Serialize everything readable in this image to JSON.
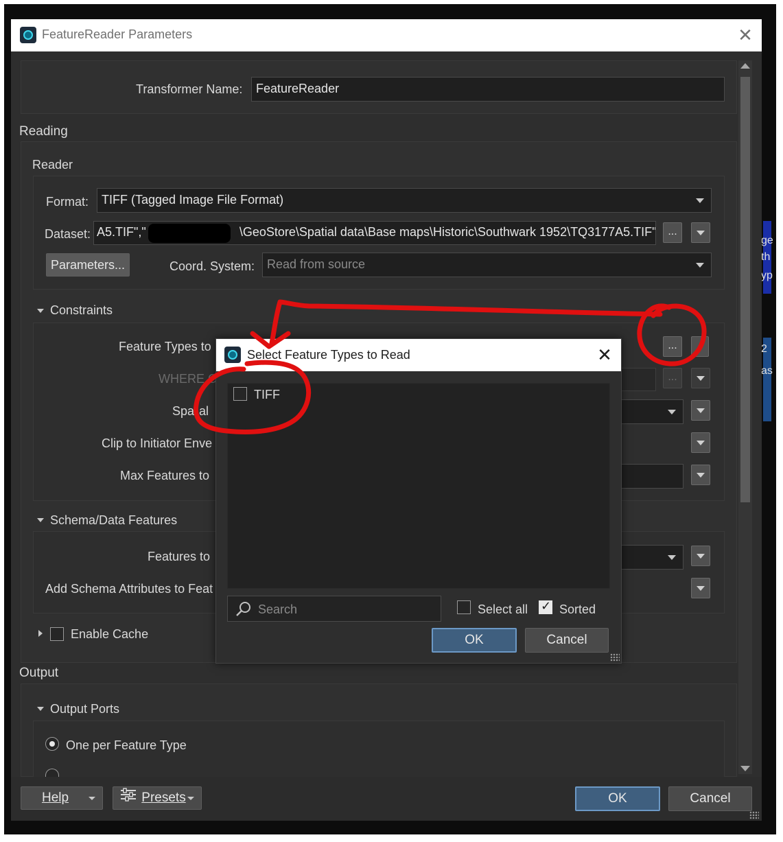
{
  "window": {
    "title": "FeatureReader Parameters",
    "close_glyph": "✕"
  },
  "transformer": {
    "label": "Transformer Name:",
    "value": "FeatureReader"
  },
  "reading": {
    "title": "Reading",
    "reader": {
      "title": "Reader",
      "format_label": "Format:",
      "format_value": "TIFF (Tagged Image File Format)",
      "dataset_label": "Dataset:",
      "dataset_value_start": "A5.TIF\",\"",
      "dataset_value_end": "\\GeoStore\\Spatial data\\Base maps\\Historic\\Southwark 1952\\TQ3177A5.TIF\"",
      "browse_label": "...",
      "parameters_button": "Parameters...",
      "coord_label": "Coord. System:",
      "coord_placeholder": "Read from source"
    },
    "constraints": {
      "title": "Constraints",
      "feature_types_label": "Feature Types to",
      "where_label": "WHERE C",
      "spatial_label_a": "Spa",
      "spatial_label_b": "al",
      "clip_label": "Clip to Initiator Enve",
      "max_features_label": "Max Features to",
      "browse_label": "...",
      "browse_label_2": "..."
    },
    "schema": {
      "title": "Schema/Data Features",
      "features_to_label": "Features to",
      "add_schema_label": "Add Schema Attributes to Feat"
    },
    "cache": {
      "label": "Enable Cache"
    }
  },
  "output": {
    "title": "Output",
    "ports": {
      "title": "Output Ports",
      "option_1": "One per Feature Type"
    }
  },
  "footer": {
    "help": "Help",
    "presets": "Presets",
    "ok": "OK",
    "cancel": "Cancel"
  },
  "popup": {
    "title": "Select Feature Types to Read",
    "close_glyph": "✕",
    "items": [
      {
        "label": "TIFF",
        "checked": false
      }
    ],
    "search_placeholder": "Search",
    "select_all": "Select all",
    "sorted": "Sorted",
    "ok": "OK",
    "cancel": "Cancel"
  },
  "background_fragments": {
    "f1": "ge",
    "f2": "th",
    "f3": "yp",
    "f4": "as",
    "f5": "2"
  },
  "colors": {
    "annotation_red": "#e01010",
    "accent_blue": "#3f5f7f",
    "bg_dark": "#2e2e2e"
  }
}
